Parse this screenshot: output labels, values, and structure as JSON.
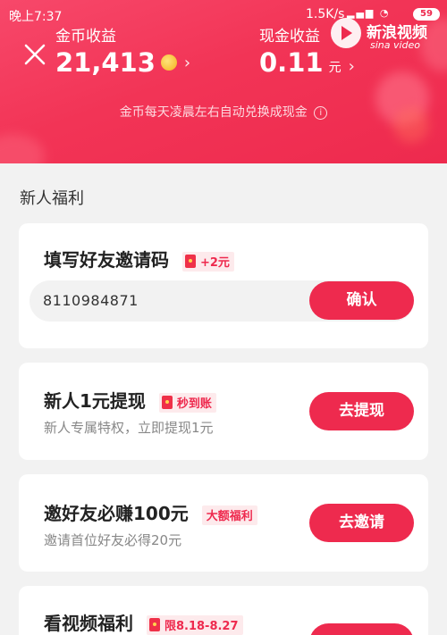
{
  "status_bar": {
    "time": "晚上7:37",
    "speed": "1.5K/s",
    "battery": "59"
  },
  "watermark": {
    "title": "新浪视频",
    "subtitle": "sina video"
  },
  "header": {
    "coin_label": "金币收益",
    "coin_value": "21,413",
    "cash_label": "现金收益",
    "cash_value": "0.11",
    "cash_unit": "元",
    "chevron": "›",
    "notice": "金币每天凌晨左右自动兑换成现金",
    "info_glyph": "i"
  },
  "section": {
    "title": "新人福利"
  },
  "cards": [
    {
      "title": "填写好友邀请码",
      "tag": "+2元",
      "input_value": "8110984871",
      "button": "确认"
    },
    {
      "title": "新人1元提现",
      "tag": "秒到账",
      "desc": "新人专属特权，立即提现1元",
      "button": "去提现"
    },
    {
      "title": "邀好友必赚100元",
      "tag": "大额福利",
      "desc": "邀请首位好友必得20元",
      "button": "去邀请"
    },
    {
      "title": "看视频福利",
      "tag": "限8.18-8.27",
      "button": ""
    }
  ],
  "colors": {
    "accent": "#ee2a4e",
    "tag_bg": "#fdeaec",
    "page_bg": "#f2f2f2"
  },
  "icons": [
    "close-icon",
    "coin-icon",
    "info-icon",
    "red-envelope-icon",
    "signal-icon",
    "wifi-icon"
  ]
}
